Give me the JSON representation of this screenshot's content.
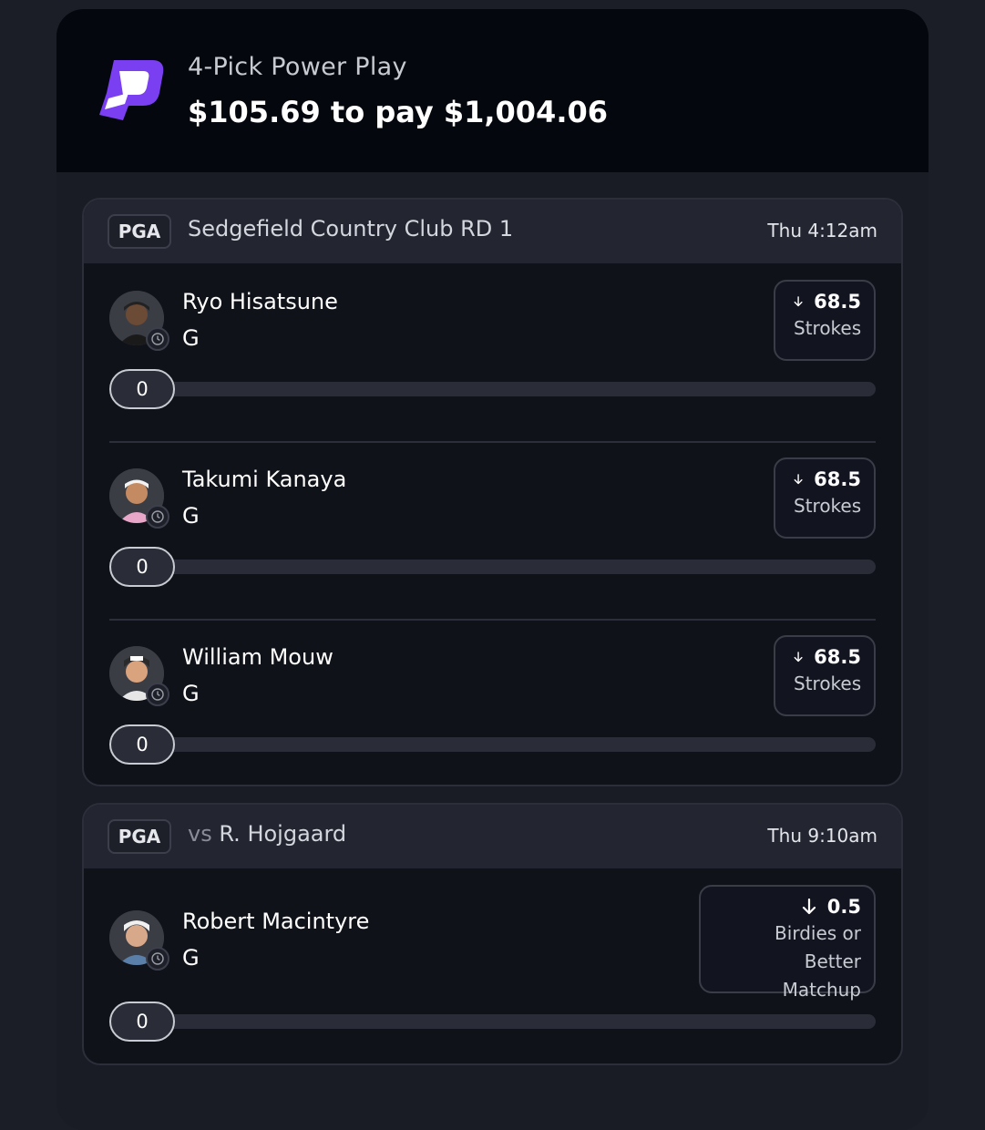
{
  "header": {
    "title": "4-Pick Power Play",
    "amount": "$105.69 to pay $1,004.06",
    "brand_color": "#7b3ff2"
  },
  "groups": [
    {
      "league": "PGA",
      "event": "Sedgefield Country Club RD 1",
      "time": "Thu 4:12am",
      "picks": [
        {
          "name": "Ryo Hisatsune",
          "position": "G",
          "line": "68.5",
          "stat": "Strokes",
          "direction": "down-arrow-icon",
          "progress": "0",
          "progress_fraction": 0
        },
        {
          "name": "Takumi Kanaya",
          "position": "G",
          "line": "68.5",
          "stat": "Strokes",
          "direction": "down-arrow-icon",
          "progress": "0",
          "progress_fraction": 0
        },
        {
          "name": "William Mouw",
          "position": "G",
          "line": "68.5",
          "stat": "Strokes",
          "direction": "down-arrow-icon",
          "progress": "0",
          "progress_fraction": 0
        }
      ]
    },
    {
      "league": "PGA",
      "event_prefix": "vs",
      "event": "R. Hojgaard",
      "time": "Thu 9:10am",
      "picks": [
        {
          "name": "Robert Macintyre",
          "position": "G",
          "line": "0.5",
          "stat_line1": "Birdies or Better",
          "stat_line2": "Matchup",
          "direction": "down-arrow-icon",
          "progress": "0",
          "progress_fraction": 0
        }
      ]
    }
  ]
}
